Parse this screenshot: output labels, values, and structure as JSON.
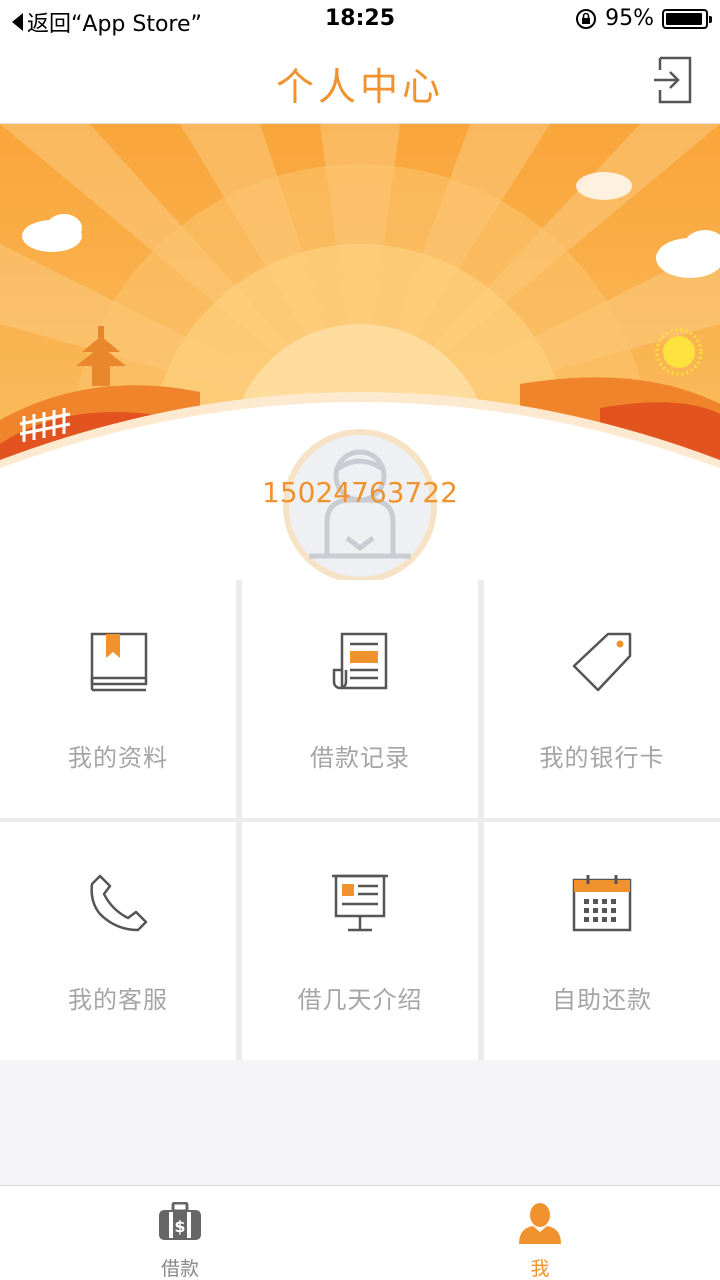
{
  "status_bar": {
    "back_label": "返回“App Store”",
    "time": "18:25",
    "battery": "95%"
  },
  "nav": {
    "title": "个人中心",
    "logout_icon": "logout-icon"
  },
  "profile": {
    "phone": "15024763722",
    "avatar_icon": "user-avatar-icon"
  },
  "menu": [
    {
      "label": "我的资料",
      "icon": "book-icon"
    },
    {
      "label": "借款记录",
      "icon": "document-icon"
    },
    {
      "label": "我的银行卡",
      "icon": "tag-icon"
    },
    {
      "label": "我的客服",
      "icon": "phone-icon"
    },
    {
      "label": "借几天介绍",
      "icon": "presentation-board-icon"
    },
    {
      "label": "自助还款",
      "icon": "calendar-icon"
    }
  ],
  "tabs": [
    {
      "label": "借款",
      "icon": "wallet-dollar-icon",
      "active": false
    },
    {
      "label": "我",
      "icon": "person-icon",
      "active": true
    }
  ],
  "colors": {
    "accent": "#f0932f",
    "banner_orange": "#f6a93b",
    "inactive_text": "#a5a5a5"
  }
}
